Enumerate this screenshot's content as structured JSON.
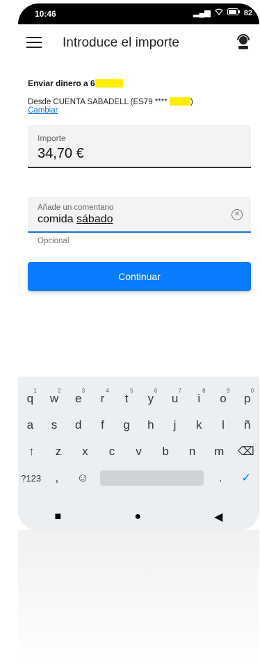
{
  "status": {
    "time": "10:46",
    "battery": "82"
  },
  "appbar": {
    "title": "Introduce el importe"
  },
  "transfer": {
    "send_to_label": "Enviar dinero a 6",
    "from_text": "Desde CUENTA SABADELL (ES79 ****",
    "from_close": ")",
    "change_link": "Cambiar"
  },
  "amount": {
    "label": "Importe",
    "value": "34,70 €"
  },
  "comment": {
    "label": "Añade un comentario",
    "value_a": "comida",
    "value_b": "sábado",
    "hint": "Opcional"
  },
  "button": {
    "continue": "Continuar"
  },
  "keyboard": {
    "row1": [
      "q",
      "w",
      "e",
      "r",
      "t",
      "y",
      "u",
      "i",
      "o",
      "p"
    ],
    "row1_nums": [
      "1",
      "2",
      "3",
      "4",
      "5",
      "6",
      "7",
      "8",
      "9",
      "0"
    ],
    "row2": [
      "a",
      "s",
      "d",
      "f",
      "g",
      "h",
      "j",
      "k",
      "l",
      "ñ"
    ],
    "row3": [
      "z",
      "x",
      "c",
      "v",
      "b",
      "n",
      "m"
    ],
    "sym": "?123",
    "comma": ",",
    "period": "."
  },
  "icons": {
    "menu": "menu-icon",
    "agent": "agent-icon",
    "clear": "clear-icon",
    "shift": "shift-icon",
    "backspace": "backspace-icon",
    "emoji": "emoji-icon",
    "enter": "check-icon"
  },
  "colors": {
    "primary": "#0a7cff",
    "link": "#1976d2",
    "mask": "#ffee00"
  }
}
